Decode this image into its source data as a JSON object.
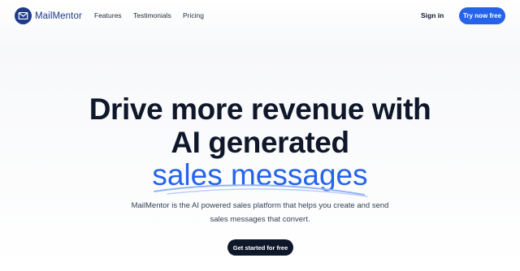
{
  "brand": {
    "name": "MailMentor",
    "icon": "envelope-logo-icon",
    "color": "#1e3a8a"
  },
  "nav": {
    "links": [
      {
        "label": "Features"
      },
      {
        "label": "Testimonials"
      },
      {
        "label": "Pricing"
      }
    ],
    "sign_in": "Sign in",
    "try_now": "Try now free"
  },
  "hero": {
    "line1": "Drive more revenue with",
    "line2": "AI generated",
    "highlight": "sales messages",
    "subtitle": "MailMentor is the AI powered sales platform that helps you create and send sales messages that convert.",
    "cta": "Get started for free"
  },
  "colors": {
    "accent": "#2563eb",
    "dark": "#0f172a",
    "highlight_underline": "#93b4f5"
  }
}
